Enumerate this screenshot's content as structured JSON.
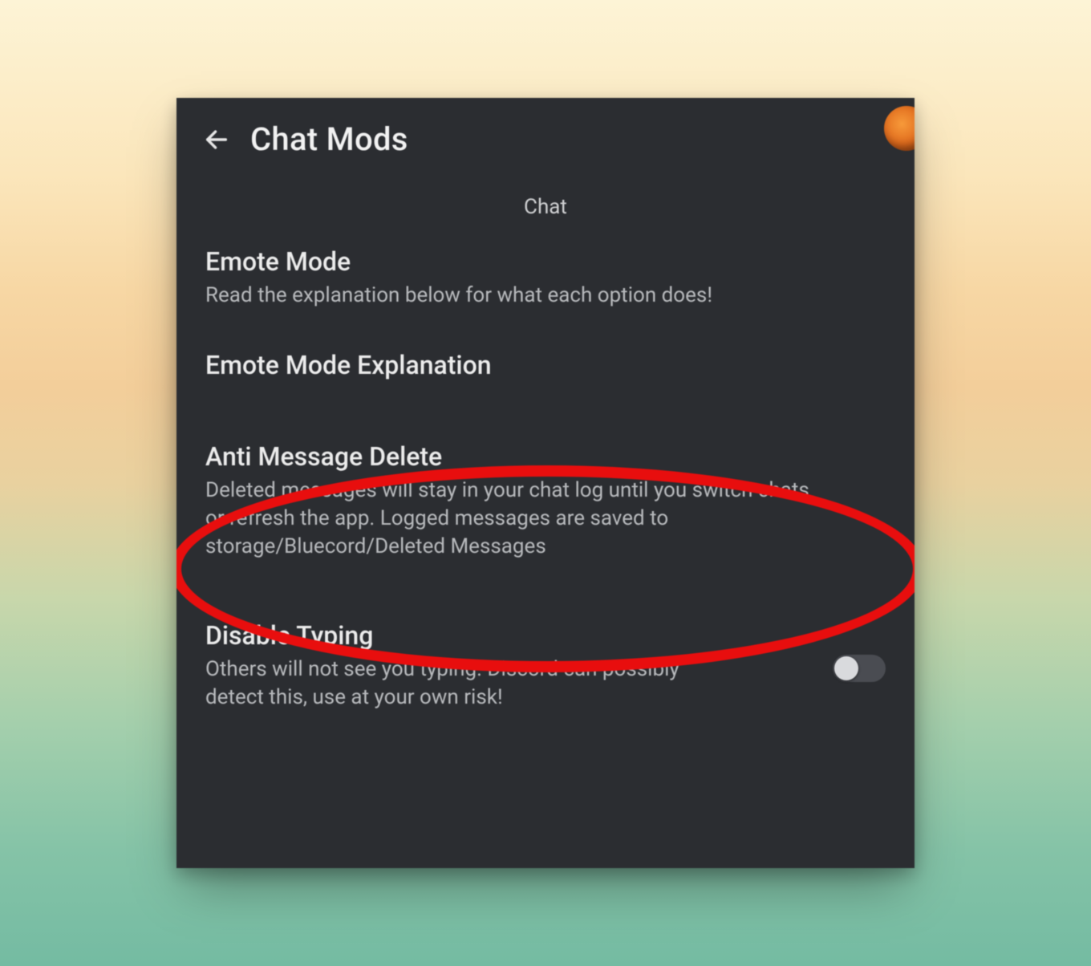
{
  "header": {
    "title": "Chat Mods"
  },
  "section_label": "Chat",
  "items": {
    "emote_mode": {
      "title": "Emote Mode",
      "desc": "Read the explanation below for what each option does!"
    },
    "emote_mode_explanation": {
      "title": "Emote Mode Explanation"
    },
    "anti_message_delete": {
      "title": "Anti Message Delete",
      "desc": "Deleted messages will stay in your chat log until you switch chats or refresh the app. Logged messages are saved to storage/Bluecord/Deleted Messages"
    },
    "disable_typing": {
      "title": "Disable Typing",
      "desc": "Others will not see you typing. Discord can possibly detect this, use at your own risk!",
      "toggle_on": false
    }
  },
  "colors": {
    "panel_bg": "#2b2d31",
    "text_primary": "#ececec",
    "text_secondary": "#b7b9bc",
    "highlight": "#e80e0e",
    "avatar": "#e06a1c"
  }
}
